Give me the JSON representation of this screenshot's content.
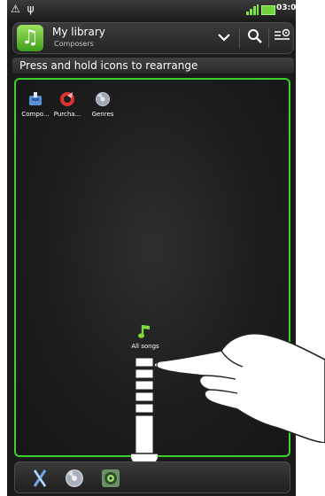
{
  "header": {
    "title": "My library",
    "subtitle": "Composers"
  },
  "hint": {
    "text": "Press and hold icons to rearrange"
  },
  "status_bar": {
    "time": "03:00",
    "left_icons": "⚠ ψ"
  },
  "tiles": [
    {
      "label": "Compo...",
      "icon": "composers-icon"
    },
    {
      "label": "Purcha...",
      "icon": "purchased-icon"
    },
    {
      "label": "Genres",
      "icon": "genres-icon"
    },
    {
      "label": "All songs",
      "icon": "music-note-icon"
    }
  ],
  "bottom_bar": {
    "icons": [
      "artists-icon",
      "albums-icon",
      "now-playing-icon"
    ]
  },
  "colors": {
    "accent": "#3bd12a",
    "background": "#1b1b1b",
    "panel": "#2a2a2a"
  }
}
